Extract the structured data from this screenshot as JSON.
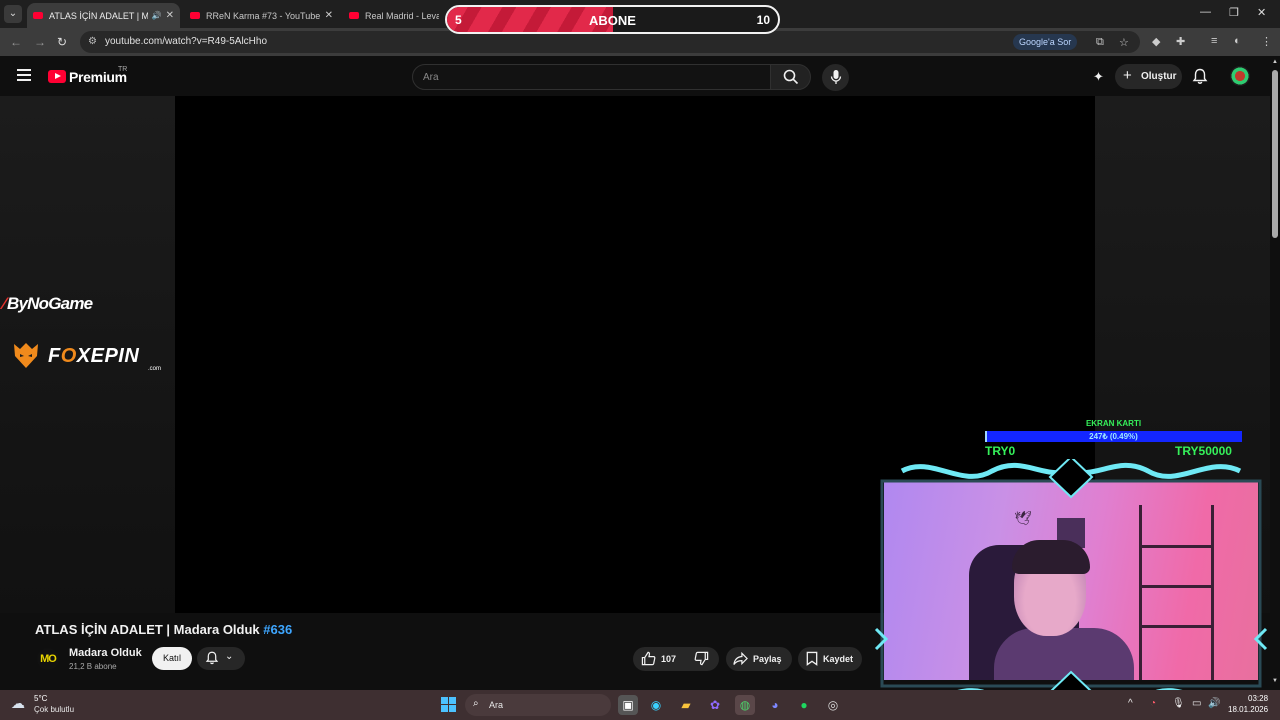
{
  "browser": {
    "tabs": [
      {
        "title": "ATLAS İÇİN ADALET | Mada",
        "active": true
      },
      {
        "title": "RReN Karma #73 - YouTube",
        "active": false
      },
      {
        "title": "Real Madrid - Levante",
        "active": false
      }
    ],
    "url": "youtube.com/watch?v=R49-5AlcHho",
    "google_ask_label": "Google'a Sor"
  },
  "sub_goal": {
    "current": "5",
    "label": "ABONE",
    "target": "10",
    "progress_fraction": 0.5
  },
  "youtube": {
    "brand": "Premium",
    "country": "TR",
    "search_placeholder": "Ara",
    "create_label": "Oluştur",
    "video_title": "ATLAS İÇİN ADALET | Madara Olduk",
    "video_tag": "#636",
    "channel": {
      "avatar_text": "MO",
      "name": "Madara Olduk",
      "subscribers": "21,2 B abone",
      "join_label": "Katıl"
    },
    "actions": {
      "likes": "107",
      "share_label": "Paylaş",
      "save_label": "Kaydet"
    }
  },
  "sponsors": {
    "bynogame": "ByNoGame",
    "foxepin_prefix": "F",
    "foxepin_o": "O",
    "foxepin_rest": "XEPIN",
    "foxepin_domain": ".com"
  },
  "donation_goal": {
    "title": "EKRAN KARTI",
    "progress_text": "247₺ (0.49%)",
    "progress_fraction": 0.0049,
    "min_label": "TRY0",
    "max_label": "TRY50000"
  },
  "taskbar": {
    "weather_temp": "5°C",
    "weather_desc": "Çok bulutlu",
    "search_placeholder": "Ara",
    "time": "03:28",
    "date": "18.01.2026"
  },
  "colors": {
    "youtube_red": "#ff0033",
    "tag_blue": "#3ea6ff",
    "goal_green": "#35f05a",
    "goal_bar_blue": "#1326ff",
    "overlay_cyan": "#6fe9f5"
  }
}
